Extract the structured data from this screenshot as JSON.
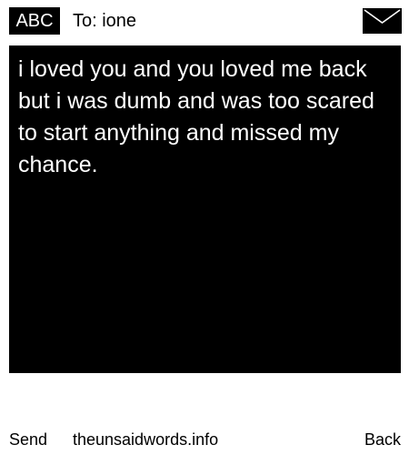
{
  "header": {
    "input_mode": "ABC",
    "recipient": "To: ione",
    "icon": "envelope-icon"
  },
  "message": {
    "text": "i loved you and you loved me back but i was dumb and was too scared to start anything and missed my chance."
  },
  "footer": {
    "send_label": "Send",
    "site_label": "theunsaidwords.info",
    "back_label": "Back"
  },
  "colors": {
    "background": "#ffffff",
    "message_background": "#000000",
    "message_text": "#ffffff",
    "ui_text": "#000000"
  }
}
